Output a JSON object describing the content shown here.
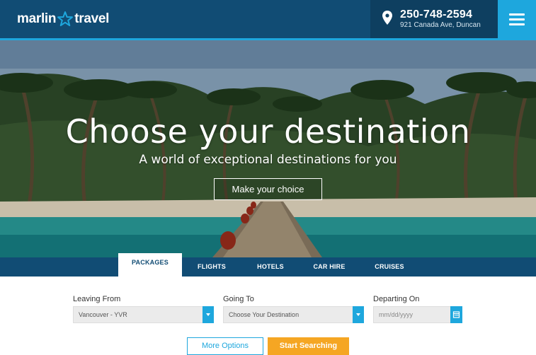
{
  "brand": {
    "logo_left": "marlin",
    "logo_right": "travel",
    "color_primary": "#114c74",
    "color_accent": "#1ea7dd",
    "color_cta": "#f5a623"
  },
  "contact": {
    "phone": "250-748-2594",
    "address": "921 Canada Ave, Duncan",
    "icon": "map-pin-icon"
  },
  "menu": {
    "icon": "hamburger-menu-icon"
  },
  "hero": {
    "title": "Choose your destination",
    "subtitle": "A world of exceptional destinations for you",
    "cta_label": "Make your choice"
  },
  "tabs": [
    {
      "label": "PACKAGES",
      "active": true
    },
    {
      "label": "FLIGHTS",
      "active": false
    },
    {
      "label": "HOTELS",
      "active": false
    },
    {
      "label": "CAR HIRE",
      "active": false
    },
    {
      "label": "CRUISES",
      "active": false
    }
  ],
  "search": {
    "leaving_from": {
      "label": "Leaving From",
      "value": "Vancouver - YVR"
    },
    "going_to": {
      "label": "Going To",
      "value": "Choose Your Destination"
    },
    "departing_on": {
      "label": "Departing On",
      "placeholder": "mm/dd/yyyy"
    },
    "more_options_label": "More Options",
    "start_search_label": "Start Searching"
  }
}
